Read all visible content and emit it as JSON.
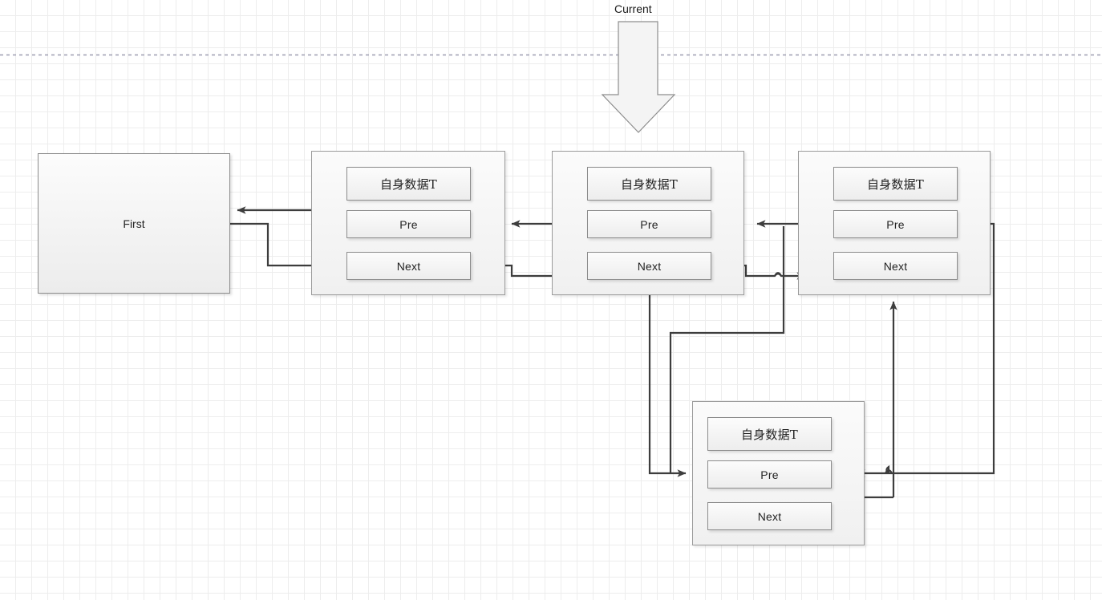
{
  "diagram": {
    "title_label": "Current",
    "background": {
      "grid": "20px minor / 100px major",
      "guide_line": "horizontal dashed"
    },
    "colors": {
      "wire": "#3d3d3d",
      "node_border": "#9a9a9a",
      "field_border": "#8c8c8c",
      "grid_minor": "#ededed",
      "grid_major": "#e2e2e2",
      "guide_dash": "#9d9db0"
    },
    "first_node": {
      "label": "First"
    },
    "fields": {
      "data": "自身数据T",
      "pre": "Pre",
      "next": "Next"
    },
    "nodes": [
      {
        "id": "node-1",
        "data": "自身数据T",
        "pre": "Pre",
        "next": "Next"
      },
      {
        "id": "node-2",
        "data": "自身数据T",
        "pre": "Pre",
        "next": "Next"
      },
      {
        "id": "node-3",
        "data": "自身数据T",
        "pre": "Pre",
        "next": "Next"
      },
      {
        "id": "node-4",
        "data": "自身数据T",
        "pre": "Pre",
        "next": "Next"
      }
    ],
    "pointer": {
      "label": "Current",
      "target": "node-2",
      "icon": "down-arrow-icon"
    }
  }
}
